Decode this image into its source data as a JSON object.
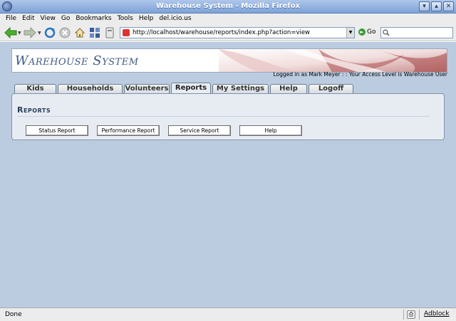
{
  "window": {
    "title": "Warehouse System - Mozilla Firefox",
    "buttons": [
      "▾",
      "▴",
      "✕"
    ]
  },
  "menubar": [
    "File",
    "Edit",
    "View",
    "Go",
    "Bookmarks",
    "Tools",
    "Help",
    "del.icio.us"
  ],
  "toolbar": {
    "url": "http://localhost/warehouse/reports/index.php?action=view",
    "go_label": "Go"
  },
  "header": {
    "app_title": "Warehouse System",
    "login_text": "Logged in as Mark Meyer : : Your Access Level is Warehouse User"
  },
  "tabs": [
    {
      "label": "Kids",
      "active": false
    },
    {
      "label": "Households",
      "active": false
    },
    {
      "label": "Volunteers",
      "active": false
    },
    {
      "label": "Reports",
      "active": true
    },
    {
      "label": "My Settings",
      "active": false
    },
    {
      "label": "Help",
      "active": false
    },
    {
      "label": "Logoff",
      "active": false
    }
  ],
  "panel": {
    "title": "Reports",
    "buttons": [
      "Status Report",
      "Performance Report",
      "Service Report",
      "Help"
    ]
  },
  "statusbar": {
    "text": "Done",
    "adblock": "Adblock"
  }
}
